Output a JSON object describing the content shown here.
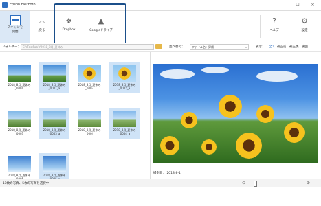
{
  "window": {
    "title": "Epson FastFoto",
    "minimize": "—",
    "maximize": "☐",
    "close": "✕"
  },
  "ribbon": {
    "scan_label_line1": "スキャンを",
    "scan_label_line2": "開始",
    "back_label": "戻る",
    "dropbox_label": "Dropbox",
    "google_label": "Googleドライブ",
    "help_label": "ヘルプ",
    "settings_label": "設定"
  },
  "toolbar": {
    "folder_label": "フォルダー：",
    "folder_path": "C:¥FastFoto¥2018_8月_夏休み",
    "sort_label": "並べ替え：",
    "sort_value": "ファイル名：昇順",
    "view_label": "表示：",
    "view_all": "全て",
    "view_original": "補正前",
    "view_corrected": "補正後",
    "view_back": "裏面"
  },
  "thumbnails": [
    {
      "caption1": "2018_8月_夏休み",
      "caption2": "_0001",
      "selected": false,
      "style": "sky"
    },
    {
      "caption1": "2018_8月_夏休み",
      "caption2": "_0001_a",
      "selected": true,
      "style": "sky"
    },
    {
      "caption1": "2018_8月_夏休み",
      "caption2": "_0002",
      "selected": false,
      "style": "sunf"
    },
    {
      "caption1": "2018_8月_夏休み",
      "caption2": "_0002_a",
      "selected": true,
      "style": "sunf"
    },
    {
      "caption1": "2018_8月_夏休み",
      "caption2": "_0003",
      "selected": false,
      "style": "bike"
    },
    {
      "caption1": "2018_8月_夏休み",
      "caption2": "_0003_a",
      "selected": true,
      "style": "bike"
    },
    {
      "caption1": "2018_8月_夏休み",
      "caption2": "_0004",
      "selected": false,
      "style": "road"
    },
    {
      "caption1": "2018_8月_夏休み",
      "caption2": "_0004_a",
      "selected": true,
      "style": "road"
    },
    {
      "caption1": "2018_8月_夏休み",
      "caption2": "_0005",
      "selected": false,
      "style": "cloud"
    },
    {
      "caption1": "2018_8月_夏休み",
      "caption2": "_0005_a",
      "selected": true,
      "style": "cloud"
    }
  ],
  "preview": {
    "date_label": "撮影日：",
    "date_value": "2018-8-1"
  },
  "status": {
    "text": "10枚の写真、5枚の写真を選択中"
  },
  "colors": {
    "accent": "#2e6fc0",
    "selection": "#cfe3f7",
    "highlight_border": "#1b4f8a"
  },
  "icons": {
    "scan": "scan-icon",
    "back": "chevron-up-icon",
    "dropbox": "dropbox-icon",
    "google": "google-drive-icon",
    "help": "question-icon",
    "settings": "gear-icon"
  }
}
